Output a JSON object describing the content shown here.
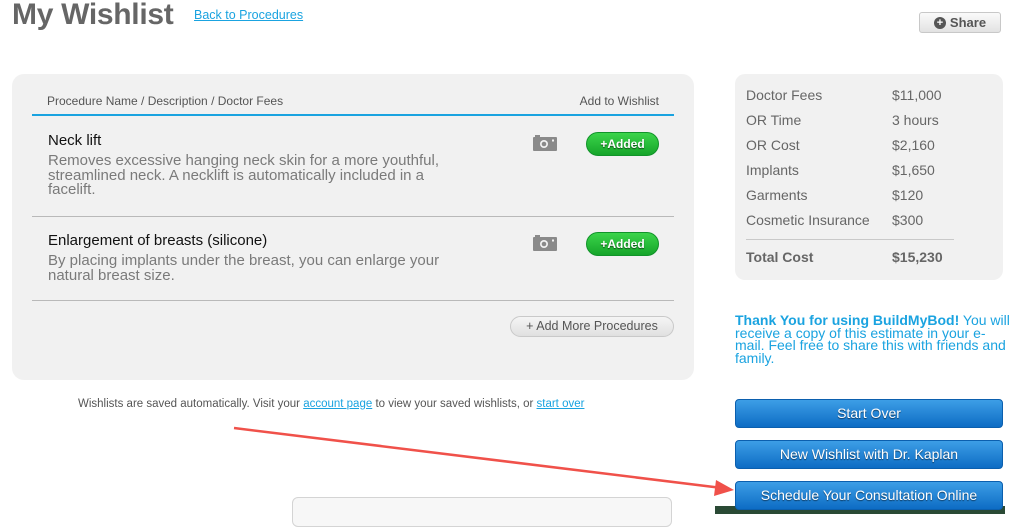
{
  "header": {
    "title": "My Wishlist",
    "back_link": "Back to Procedures",
    "share_label": "Share",
    "share_icon": "plus-circle-icon"
  },
  "wishlist": {
    "col_left": "Procedure Name / Description / Doctor Fees",
    "col_right": "Add to Wishlist",
    "procedures": [
      {
        "name": "Neck lift",
        "description": "Removes excessive hanging neck skin for a more youthful, streamlined neck. A necklift is automatically included in a facelift.",
        "photo_icon": "camera-icon",
        "status_label": "+Added"
      },
      {
        "name": "Enlargement of breasts (silicone)",
        "description": "By placing implants under the breast, you can enlarge your natural breast size.",
        "photo_icon": "camera-icon",
        "status_label": "+Added"
      }
    ],
    "add_more_label": "+ Add More Procedures"
  },
  "costs": {
    "rows": [
      {
        "label": "Doctor Fees",
        "value": "$11,000"
      },
      {
        "label": "OR Time",
        "value": "3 hours"
      },
      {
        "label": "OR Cost",
        "value": "$2,160"
      },
      {
        "label": "Implants",
        "value": "$1,650"
      },
      {
        "label": "Garments",
        "value": "$120"
      },
      {
        "label": "Cosmetic Insurance",
        "value": "$300"
      }
    ],
    "total_label": "Total Cost",
    "total_value": "$15,230"
  },
  "thanks": {
    "bold": "Thank You for using BuildMyBod!",
    "rest": " You will receive a copy of this estimate in your e-mail. Feel free to share this with friends and family."
  },
  "footer": {
    "text_before": "Wishlists are saved automatically. Visit your ",
    "account_link": "account page",
    "text_middle": " to view your saved wishlists, or ",
    "start_over_link": "start over"
  },
  "actions": {
    "start_over": "Start Over",
    "new_wishlist": "New Wishlist with Dr. Kaplan",
    "schedule": "Schedule Your Consultation Online"
  },
  "colors": {
    "accent_blue": "#1aa3e0",
    "added_green": "#16a52a",
    "button_blue": "#0d6cc4",
    "annotation_arrow": "#f0514a"
  }
}
